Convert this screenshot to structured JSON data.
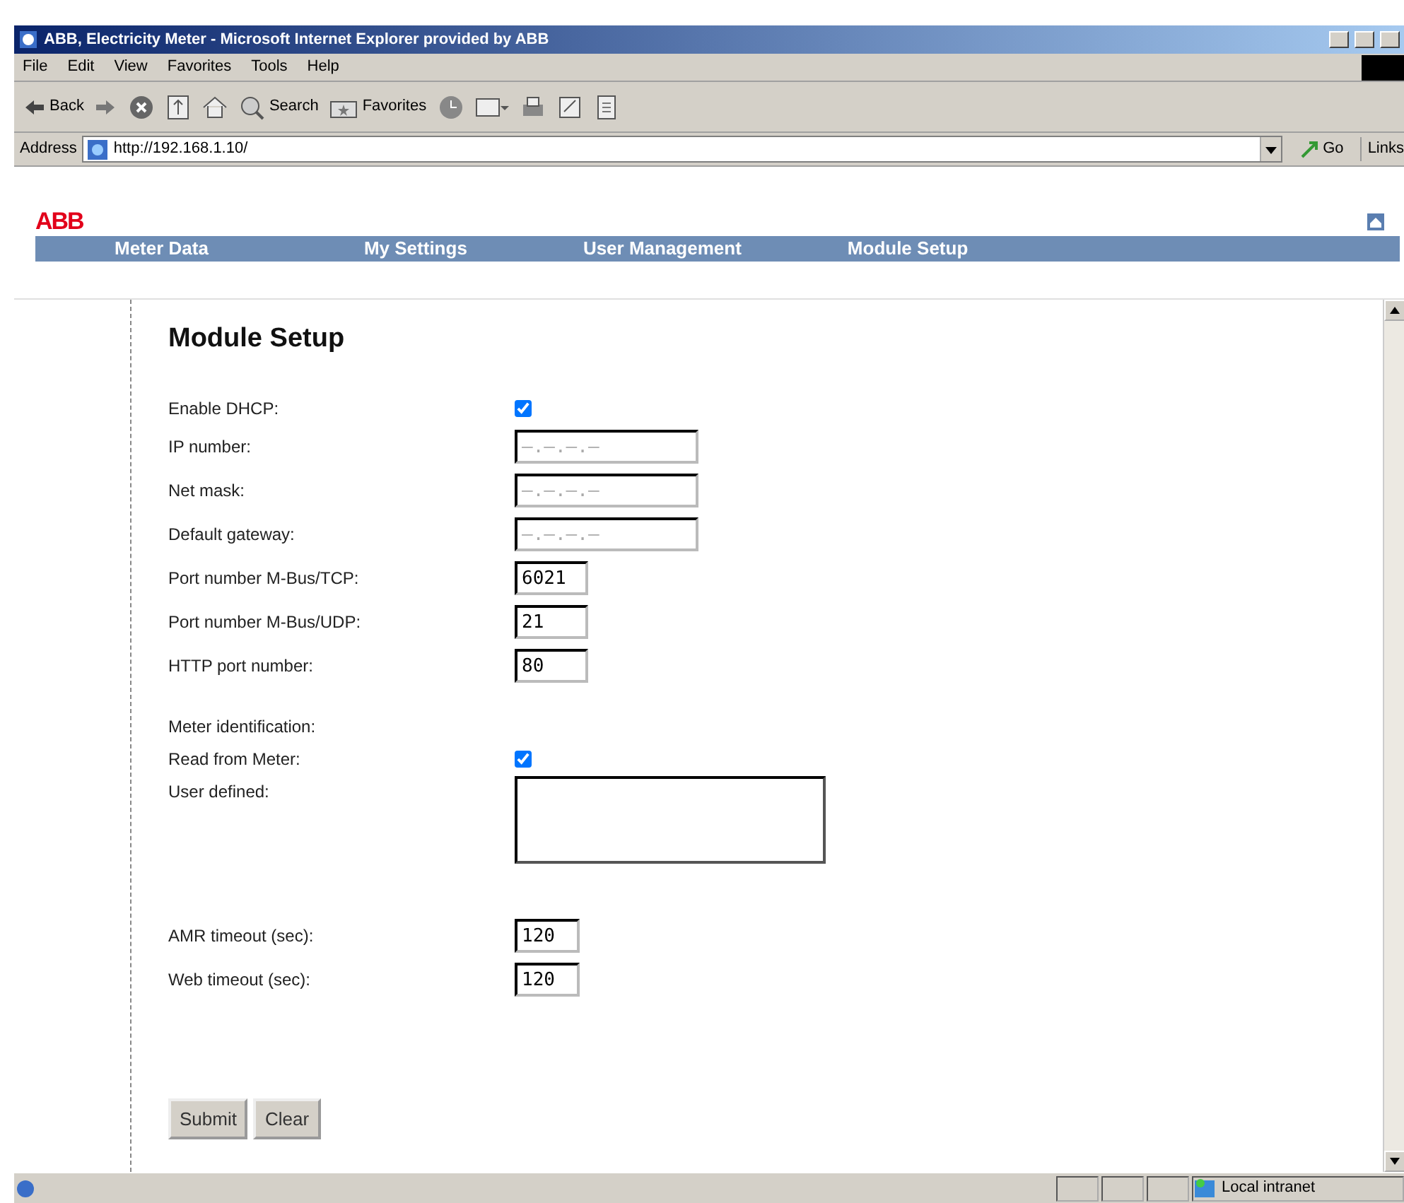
{
  "window": {
    "title": "ABB, Electricity Meter - Microsoft Internet Explorer provided by ABB"
  },
  "menu": [
    "File",
    "Edit",
    "View",
    "Favorites",
    "Tools",
    "Help"
  ],
  "toolbar": {
    "back": "Back",
    "search": "Search",
    "favorites": "Favorites"
  },
  "address_bar": {
    "label": "Address",
    "value": "http://192.168.1.10/",
    "go": "Go",
    "links": "Links"
  },
  "page": {
    "logo": "ABB",
    "nav": [
      "Meter Data",
      "My Settings",
      "User Management",
      "Module Setup"
    ],
    "heading": "Module Setup",
    "fields": [
      {
        "kind": "checkbox",
        "label": "Enable DHCP:",
        "checked": true
      },
      {
        "kind": "address",
        "label": "IP number:",
        "value": "—.—.—.—",
        "disabled": true
      },
      {
        "kind": "address",
        "label": "Net mask:",
        "value": "—.—.—.—",
        "disabled": true
      },
      {
        "kind": "address",
        "label": "Default gateway:",
        "value": "—.—.—.—",
        "disabled": true
      },
      {
        "kind": "port",
        "label": "Port number M-Bus/TCP:",
        "value": "6021",
        "disabled": false
      },
      {
        "kind": "port",
        "label": "Port number M-Bus/UDP:",
        "value": "21",
        "disabled": false
      },
      {
        "kind": "port",
        "label": "HTTP port number:",
        "value": "80",
        "disabled": false
      },
      {
        "kind": "section",
        "label": "Meter identification:"
      },
      {
        "kind": "checkbox",
        "label": "Read from Meter:",
        "checked": true
      },
      {
        "kind": "textarea",
        "label": "User defined:"
      },
      {
        "kind": "timeout",
        "label": "AMR timeout (sec):",
        "value": "120",
        "disabled": false
      },
      {
        "kind": "timeout",
        "label": "Web timeout (sec):",
        "value": "120",
        "disabled": false
      }
    ],
    "buttons": [
      "Submit",
      "Clear"
    ]
  },
  "status_bar": {
    "zone": "Local intranet"
  }
}
